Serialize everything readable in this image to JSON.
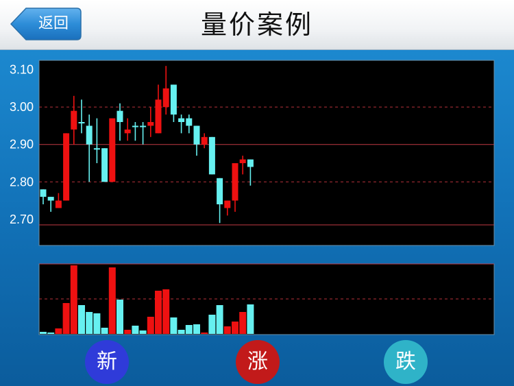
{
  "header": {
    "back_label": "返回",
    "title": "量价案例"
  },
  "colors": {
    "up": "#ee1111",
    "down": "#66f0f0",
    "grid_dashed": "#b8323a",
    "grid_solid": "#c23a44",
    "background": "#000000",
    "btn_new": "#2f3bd9",
    "btn_rise": "#c21a1a",
    "btn_fall": "#2fb3c8"
  },
  "chart_data": {
    "type": "candlestick",
    "y_axis_ticks": [
      "3.10",
      "3.00",
      "2.90",
      "2.80",
      "2.70"
    ],
    "ylim": [
      2.63,
      3.125
    ],
    "gridlines_dashed": [
      3.0,
      2.8
    ],
    "gridlines_solid": [
      2.9,
      2.685
    ],
    "candles": [
      {
        "o": 2.78,
        "c": 2.76,
        "h": 2.78,
        "l": 2.74
      },
      {
        "o": 2.76,
        "c": 2.75,
        "h": 2.76,
        "l": 2.72
      },
      {
        "o": 2.73,
        "c": 2.75,
        "h": 2.77,
        "l": 2.73
      },
      {
        "o": 2.75,
        "c": 2.93,
        "h": 2.93,
        "l": 2.75
      },
      {
        "o": 2.94,
        "c": 2.99,
        "h": 3.03,
        "l": 2.9
      },
      {
        "o": 2.96,
        "c": 2.96,
        "h": 3.02,
        "l": 2.93
      },
      {
        "o": 2.95,
        "c": 2.9,
        "h": 2.98,
        "l": 2.8
      },
      {
        "o": 2.89,
        "c": 2.89,
        "h": 2.97,
        "l": 2.85
      },
      {
        "o": 2.89,
        "c": 2.8,
        "h": 2.89,
        "l": 2.8
      },
      {
        "o": 2.8,
        "c": 2.97,
        "h": 2.97,
        "l": 2.8
      },
      {
        "o": 2.99,
        "c": 2.96,
        "h": 3.01,
        "l": 2.91
      },
      {
        "o": 2.93,
        "c": 2.94,
        "h": 2.97,
        "l": 2.91
      },
      {
        "o": 2.95,
        "c": 2.95,
        "h": 2.96,
        "l": 2.91
      },
      {
        "o": 2.95,
        "c": 2.95,
        "h": 2.96,
        "l": 2.9
      },
      {
        "o": 2.95,
        "c": 2.96,
        "h": 3.0,
        "l": 2.92
      },
      {
        "o": 2.93,
        "c": 3.02,
        "h": 3.06,
        "l": 2.93
      },
      {
        "o": 3.0,
        "c": 3.05,
        "h": 3.11,
        "l": 2.98
      },
      {
        "o": 3.06,
        "c": 2.98,
        "h": 3.06,
        "l": 2.96
      },
      {
        "o": 2.97,
        "c": 2.96,
        "h": 2.98,
        "l": 2.93
      },
      {
        "o": 2.97,
        "c": 2.95,
        "h": 2.98,
        "l": 2.93
      },
      {
        "o": 2.95,
        "c": 2.9,
        "h": 2.95,
        "l": 2.87
      },
      {
        "o": 2.9,
        "c": 2.92,
        "h": 2.93,
        "l": 2.89
      },
      {
        "o": 2.92,
        "c": 2.82,
        "h": 2.92,
        "l": 2.82
      },
      {
        "o": 2.81,
        "c": 2.74,
        "h": 2.81,
        "l": 2.69
      },
      {
        "o": 2.73,
        "c": 2.75,
        "h": 2.75,
        "l": 2.71
      },
      {
        "o": 2.75,
        "c": 2.85,
        "h": 2.85,
        "l": 2.72
      },
      {
        "o": 2.85,
        "c": 2.86,
        "h": 2.87,
        "l": 2.82
      },
      {
        "o": 2.86,
        "c": 2.84,
        "h": 2.86,
        "l": 2.79
      }
    ],
    "volume": [
      3,
      2,
      8,
      45,
      100,
      42,
      32,
      30,
      9,
      97,
      50,
      6,
      12,
      5,
      25,
      63,
      65,
      24,
      6,
      13,
      14,
      2,
      28,
      42,
      11,
      18,
      32,
      43
    ],
    "volume_max": 100
  },
  "buttons": {
    "new_label": "新",
    "rise_label": "涨",
    "fall_label": "跌"
  }
}
